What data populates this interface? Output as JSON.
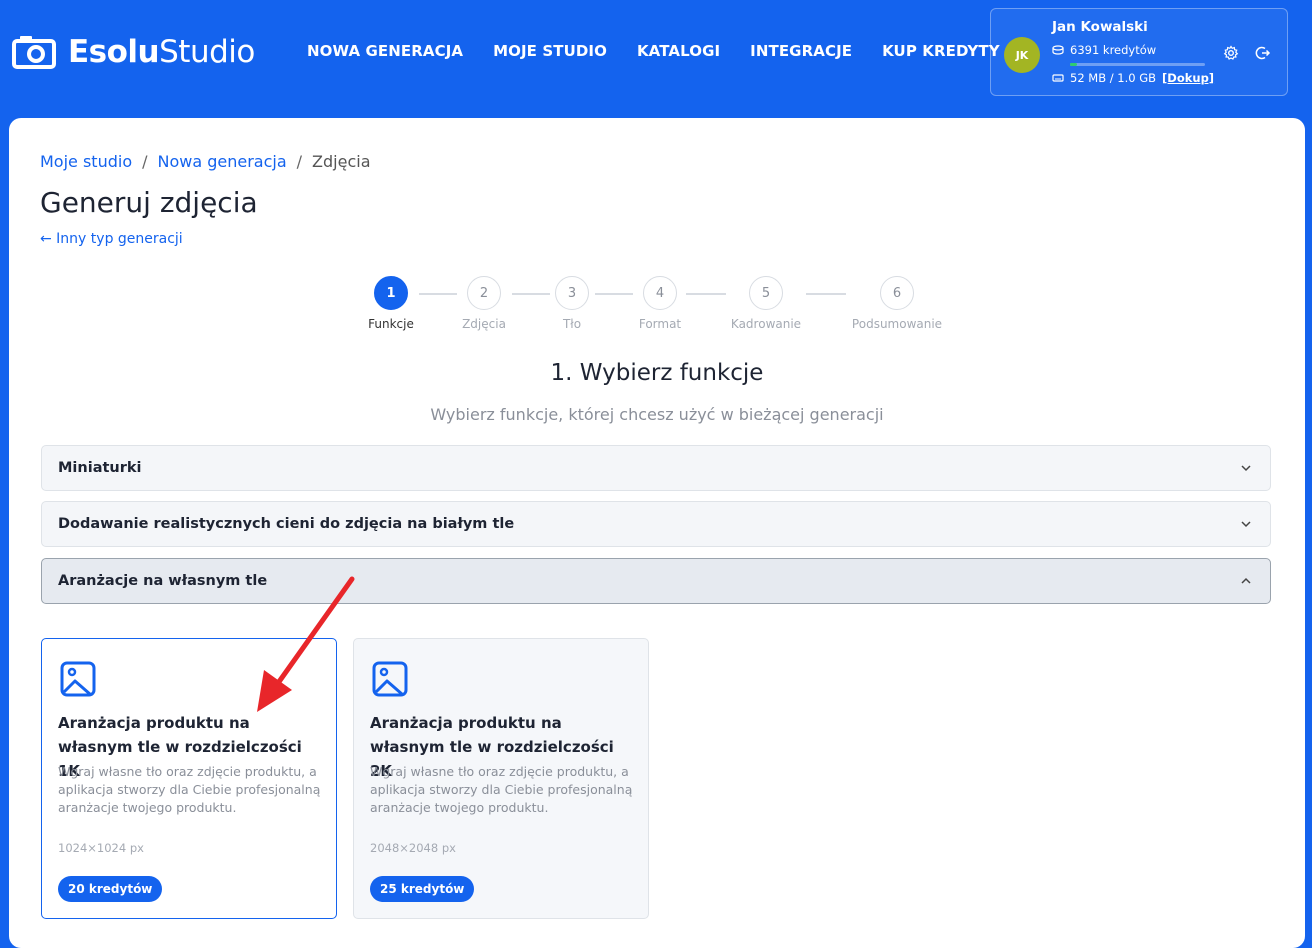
{
  "header": {
    "logo_bold": "Esolu",
    "logo_light": "Studio",
    "nav": [
      {
        "label": "NOWA GENERACJA"
      },
      {
        "label": "MOJE STUDIO"
      },
      {
        "label": "KATALOGI"
      },
      {
        "label": "INTEGRACJE"
      },
      {
        "label": "KUP KREDYTY"
      }
    ],
    "user": {
      "initials": "JK",
      "name": "Jan Kowalski",
      "credits": "6391 kredytów",
      "storage": "52 MB / 1.0 GB",
      "storage_fraction": 0.05,
      "topup": "[Dokup]",
      "avatar_color": "#a3b523"
    },
    "icons": [
      "camera-icon",
      "coins-icon",
      "drive-icon",
      "gear-icon",
      "logout-icon"
    ]
  },
  "breadcrumb": [
    {
      "label": "Moje studio"
    },
    {
      "label": "Nowa generacja"
    },
    {
      "label": "Zdjęcia"
    }
  ],
  "page_title": "Generuj zdjęcia",
  "back_link": "← Inny typ generacji",
  "steps": [
    {
      "num": "1",
      "label": "Funkcje",
      "active": true
    },
    {
      "num": "2",
      "label": "Zdjęcia"
    },
    {
      "num": "3",
      "label": "Tło"
    },
    {
      "num": "4",
      "label": "Format"
    },
    {
      "num": "5",
      "label": "Kadrowanie"
    },
    {
      "num": "6",
      "label": "Podsumowanie"
    }
  ],
  "section": {
    "title": "1. Wybierz funkcje",
    "subtitle": "Wybierz funkcje, której chcesz użyć w bieżącej generacji"
  },
  "accordions": [
    {
      "label": "Miniaturki",
      "open": false
    },
    {
      "label": "Dodawanie realistycznych cieni do zdjęcia na białym tle",
      "open": false
    },
    {
      "label": "Aranżacje na własnym tle",
      "open": true
    }
  ],
  "cards": [
    {
      "title": "Aranżacja produktu na własnym tle w rozdzielczości 1K",
      "description": "Wgraj własne tło oraz zdjęcie produktu, a aplikacja stworzy dla Ciebie profesjonalną aranżacje twojego produktu.",
      "size": "1024×1024 px",
      "price": "20 kredytów",
      "selected": true
    },
    {
      "title": "Aranżacja produktu na własnym tle w rozdzielczości 2K",
      "description": "Wgraj własne tło oraz zdjęcie produktu, a aplikacja stworzy dla Ciebie profesjonalną aranżacje twojego produktu.",
      "size": "2048×2048 px",
      "price": "25 kredytów",
      "selected": false
    }
  ],
  "colors": {
    "brand_blue": "#1463ee",
    "annotation_arrow": "#e8262a",
    "storage_green": "#2ecc71"
  }
}
